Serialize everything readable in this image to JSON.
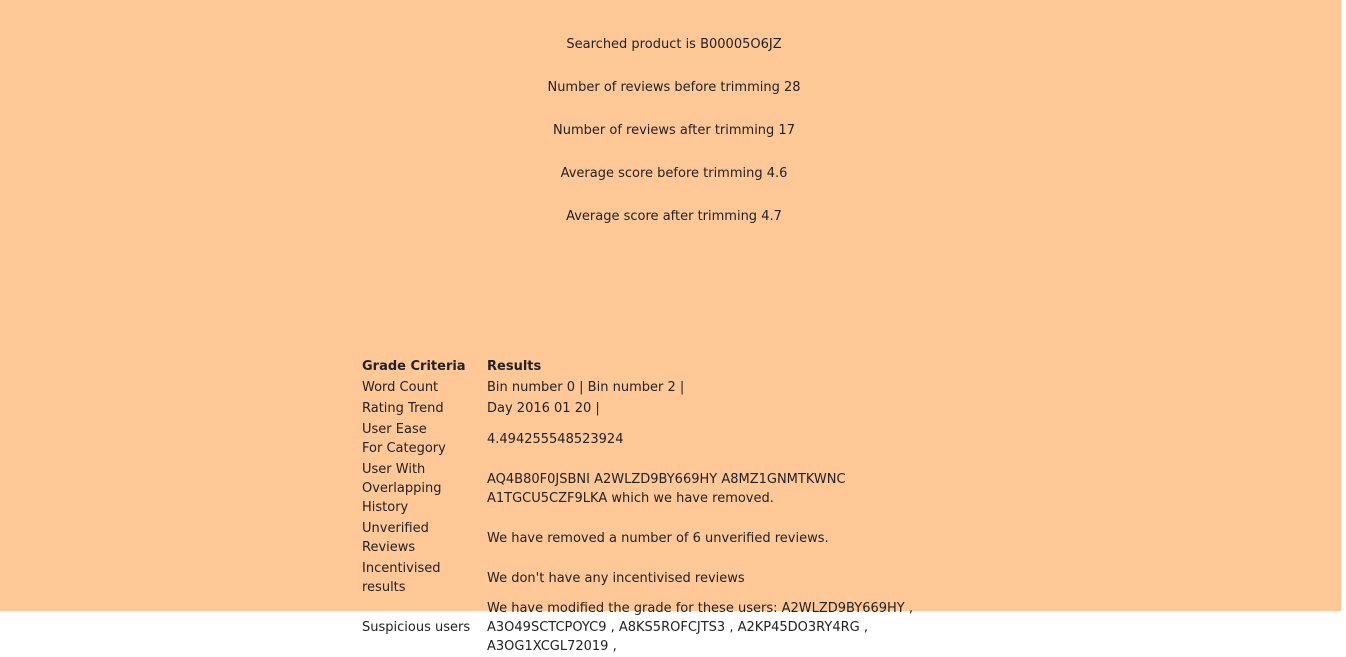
{
  "summary": {
    "searched_product": "Searched product is B00005O6JZ",
    "reviews_before": "Number of reviews before trimming 28",
    "reviews_after": "Number of reviews after trimming 17",
    "avg_before": "Average score before trimming 4.6",
    "avg_after": "Average score after trimming 4.7"
  },
  "grades_table": {
    "headers": {
      "criteria": "Grade Criteria",
      "results": "Results"
    },
    "rows": [
      {
        "criteria": "Word Count",
        "result": "Bin number 0 | Bin number 2 |"
      },
      {
        "criteria": "Rating Trend",
        "result": "Day 2016 01 20 |"
      },
      {
        "criteria_line1": "User Ease",
        "criteria_line2": "For Category",
        "result": "4.494255548523924"
      },
      {
        "criteria_line1": "User With",
        "criteria_line2": "Overlapping History",
        "result": "AQ4B80F0JSBNI A2WLZD9BY669HY A8MZ1GNMTKWNC A1TGCU5CZF9LKA which we have removed."
      },
      {
        "criteria": "Unverified Reviews",
        "result": "We have removed a number of 6 unverified reviews."
      },
      {
        "criteria": "Incentivised results",
        "result": "We don't have any incentivised reviews"
      },
      {
        "criteria": "Suspicious users",
        "result": "We have modified the grade for these users: A2WLZD9BY669HY , A3O49SCTCPOYC9 , A8KS5ROFCJTS3 , A2KP45DO3RY4RG , A3OG1XCGL72019 ,"
      }
    ]
  },
  "colors": {
    "page_background": "#ffc896",
    "text": "#222222"
  }
}
